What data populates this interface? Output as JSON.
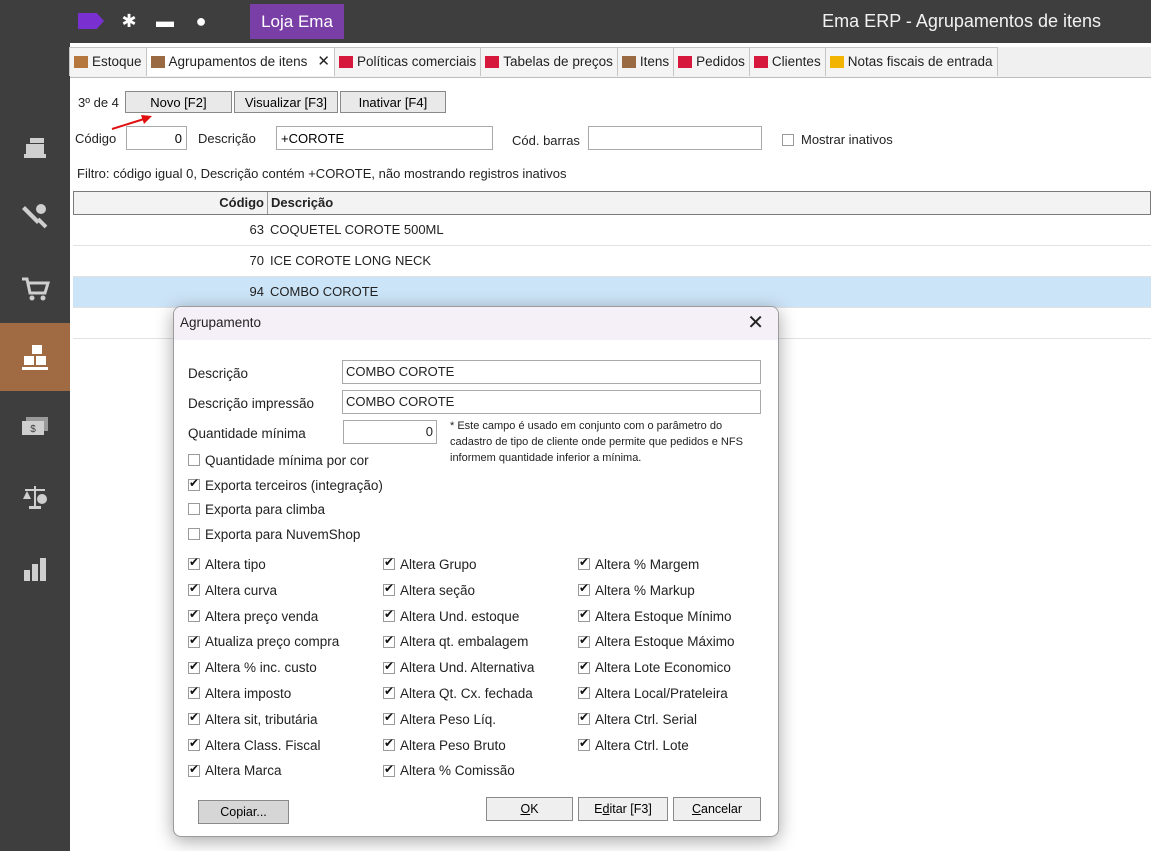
{
  "topbar": {
    "store_label": "Loja Ema",
    "app_title": "Ema ERP - Agrupamentos de itens"
  },
  "tabs": [
    {
      "label": "Estoque",
      "color": "#b5773e"
    },
    {
      "label": "Agrupamentos de itens",
      "color": "#9a6b43",
      "active": true
    },
    {
      "label": "Políticas comerciais",
      "color": "#d6183c"
    },
    {
      "label": "Tabelas de preços",
      "color": "#d6183c"
    },
    {
      "label": "Itens",
      "color": "#9a6b43"
    },
    {
      "label": "Pedidos",
      "color": "#d6183c"
    },
    {
      "label": "Clientes",
      "color": "#d6183c"
    },
    {
      "label": "Notas fiscais de entrada",
      "color": "#f2b400"
    }
  ],
  "toolbar": {
    "counter": "3º de 4",
    "new_label": "Novo [F2]",
    "view_label": "Visualizar [F3]",
    "deactivate_label": "Inativar [F4]"
  },
  "filter": {
    "code_label": "Código",
    "code_value": "0",
    "desc_label": "Descrição",
    "desc_value": "+COROTE",
    "barcode_label": "Cód. barras",
    "barcode_value": "",
    "show_inactive_label": "Mostrar inativos",
    "summary": "Filtro: código igual 0, Descrição  contém +COROTE,  não mostrando registros inativos"
  },
  "grid": {
    "headers": [
      "Código",
      "Descrição"
    ],
    "rows": [
      {
        "code": "63",
        "desc": "COQUETEL COROTE 500ML"
      },
      {
        "code": "70",
        "desc": "ICE COROTE LONG NECK"
      },
      {
        "code": "94",
        "desc": "COMBO COROTE"
      }
    ]
  },
  "dialog": {
    "title": "Agrupamento",
    "desc_label": "Descrição",
    "desc_value": "COMBO COROTE",
    "print_desc_label": "Descrição impressão",
    "print_desc_value": "COMBO COROTE",
    "min_qty_label": "Quantidade mínima",
    "min_qty_value": "0",
    "note": "* Este campo é usado em conjunto com o parâmetro do cadastro de tipo de cliente onde permite que pedidos e NFS informem quantidade inferior a mínima.",
    "options": [
      {
        "label": "Quantidade mínima por cor",
        "checked": false
      },
      {
        "label": "Exporta terceiros (integração)",
        "checked": true
      },
      {
        "label": "Exporta para climba",
        "checked": false
      },
      {
        "label": "Exporta para NuvemShop",
        "checked": false
      }
    ],
    "col1": [
      {
        "label": "Altera tipo",
        "checked": true
      },
      {
        "label": "Altera curva",
        "checked": true
      },
      {
        "label": "Altera preço venda",
        "checked": true
      },
      {
        "label": "Atualiza preço compra",
        "checked": true
      },
      {
        "label": "Altera % inc. custo",
        "checked": true
      },
      {
        "label": "Altera imposto",
        "checked": true
      },
      {
        "label": "Altera sit, tributária",
        "checked": true
      },
      {
        "label": "Altera Class. Fiscal",
        "checked": true
      },
      {
        "label": "Altera Marca",
        "checked": true
      }
    ],
    "col2": [
      {
        "label": "Altera Grupo",
        "checked": true
      },
      {
        "label": "Altera seção",
        "checked": true
      },
      {
        "label": "Altera Und. estoque",
        "checked": true
      },
      {
        "label": "Altera qt. embalagem",
        "checked": true
      },
      {
        "label": "Altera Und. Alternativa",
        "checked": true
      },
      {
        "label": "Altera Qt. Cx. fechada",
        "checked": true
      },
      {
        "label": "Altera Peso Líq.",
        "checked": true
      },
      {
        "label": "Altera Peso Bruto",
        "checked": true
      },
      {
        "label": "Altera % Comissão",
        "checked": true
      }
    ],
    "col3": [
      {
        "label": "Altera % Margem",
        "checked": true
      },
      {
        "label": "Altera % Markup",
        "checked": true
      },
      {
        "label": "Altera Estoque Mínimo",
        "checked": true
      },
      {
        "label": "Altera Estoque Máximo",
        "checked": true
      },
      {
        "label": "Altera Lote Economico",
        "checked": true
      },
      {
        "label": "Altera Local/Prateleira",
        "checked": true
      },
      {
        "label": "Altera Ctrl. Serial",
        "checked": true
      },
      {
        "label": "Altera Ctrl. Lote",
        "checked": true
      }
    ],
    "copy_label": "Copiar...",
    "ok_label": "OK",
    "edit_label": "Editar [F3]",
    "cancel_label": "Cancelar"
  }
}
